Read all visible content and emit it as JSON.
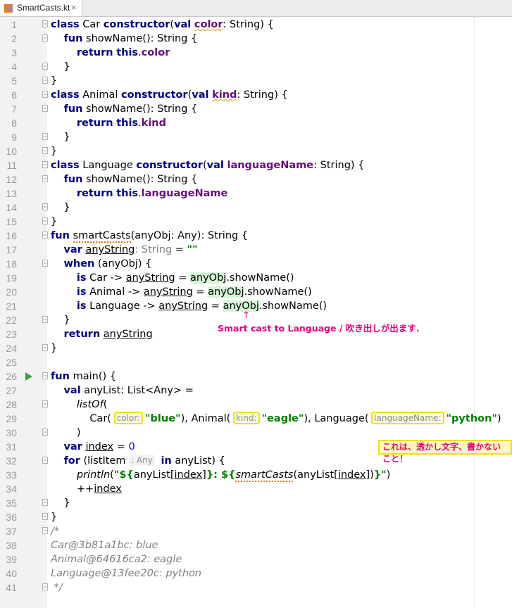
{
  "tab": {
    "filename": "SmartCasts.kt",
    "close": "×"
  },
  "lines": [
    {
      "n": "1"
    },
    {
      "n": "2"
    },
    {
      "n": "3"
    },
    {
      "n": "4"
    },
    {
      "n": "5"
    },
    {
      "n": "6"
    },
    {
      "n": "7"
    },
    {
      "n": "8"
    },
    {
      "n": "9"
    },
    {
      "n": "10"
    },
    {
      "n": "11"
    },
    {
      "n": "12"
    },
    {
      "n": "13"
    },
    {
      "n": "14"
    },
    {
      "n": "15"
    },
    {
      "n": "16"
    },
    {
      "n": "17"
    },
    {
      "n": "18"
    },
    {
      "n": "19"
    },
    {
      "n": "20"
    },
    {
      "n": "21"
    },
    {
      "n": "22"
    },
    {
      "n": "23"
    },
    {
      "n": "24"
    },
    {
      "n": "25"
    },
    {
      "n": "26"
    },
    {
      "n": "27"
    },
    {
      "n": "28"
    },
    {
      "n": "29"
    },
    {
      "n": "30"
    },
    {
      "n": "31"
    },
    {
      "n": "32"
    },
    {
      "n": "33"
    },
    {
      "n": "34"
    },
    {
      "n": "35"
    },
    {
      "n": "36"
    },
    {
      "n": "37"
    },
    {
      "n": "38"
    },
    {
      "n": "39"
    },
    {
      "n": "40"
    },
    {
      "n": "41"
    }
  ],
  "code": {
    "kw_class": "class",
    "kw_constructor": "constructor",
    "kw_val": "val",
    "kw_var": "var",
    "kw_fun": "fun",
    "kw_return": "return",
    "kw_this": "this",
    "kw_when": "when",
    "kw_is": "is",
    "kw_for": "for",
    "kw_in": "in",
    "car": "Car",
    "animal": "Animal",
    "language": "Language",
    "color": "color",
    "kind": "kind",
    "languageName": "languageName",
    "string_type": "String",
    "showName": "showName",
    "smartCasts": "smartCasts",
    "anyObj": "anyObj",
    "any": "Any",
    "anyString": "anyString",
    "empty_str": "\"\"",
    "main": "main",
    "anyList": "anyList",
    "list_any": "List<Any>",
    "listOf": "listOf",
    "blue": "\"blue\"",
    "eagle": "\"eagle\"",
    "python": "\"python\"",
    "index": "index",
    "zero": "0",
    "listItem": "listItem",
    "println": "println",
    "str_open": "\"${",
    "str_mid": "}: ${",
    "str_close": "}\"",
    "inc": "++",
    "cmt_open": "/*",
    "out1": "Car@3b81a1bc: blue",
    "out2": "Animal@64616ca2: eagle",
    "out3": "Language@13fee20c: python",
    "cmt_close": " */"
  },
  "hints": {
    "string": "String",
    "color": "color:",
    "kind": "kind:",
    "languageName": "languageName:",
    "any": ": Any"
  },
  "notes": {
    "arrow": "↑",
    "smart_cast": "Smart cast to Language / 吹き出しが出ます.",
    "warning": "これは、透かし文字、書かないこと！"
  },
  "colors": {
    "keyword": "#000080",
    "field": "#660e7a",
    "string": "#008000",
    "number": "#0000ff",
    "annotation": "#e6007e",
    "highlight_box": "#f0e000",
    "smartcast_bg": "#d6f5d6"
  }
}
